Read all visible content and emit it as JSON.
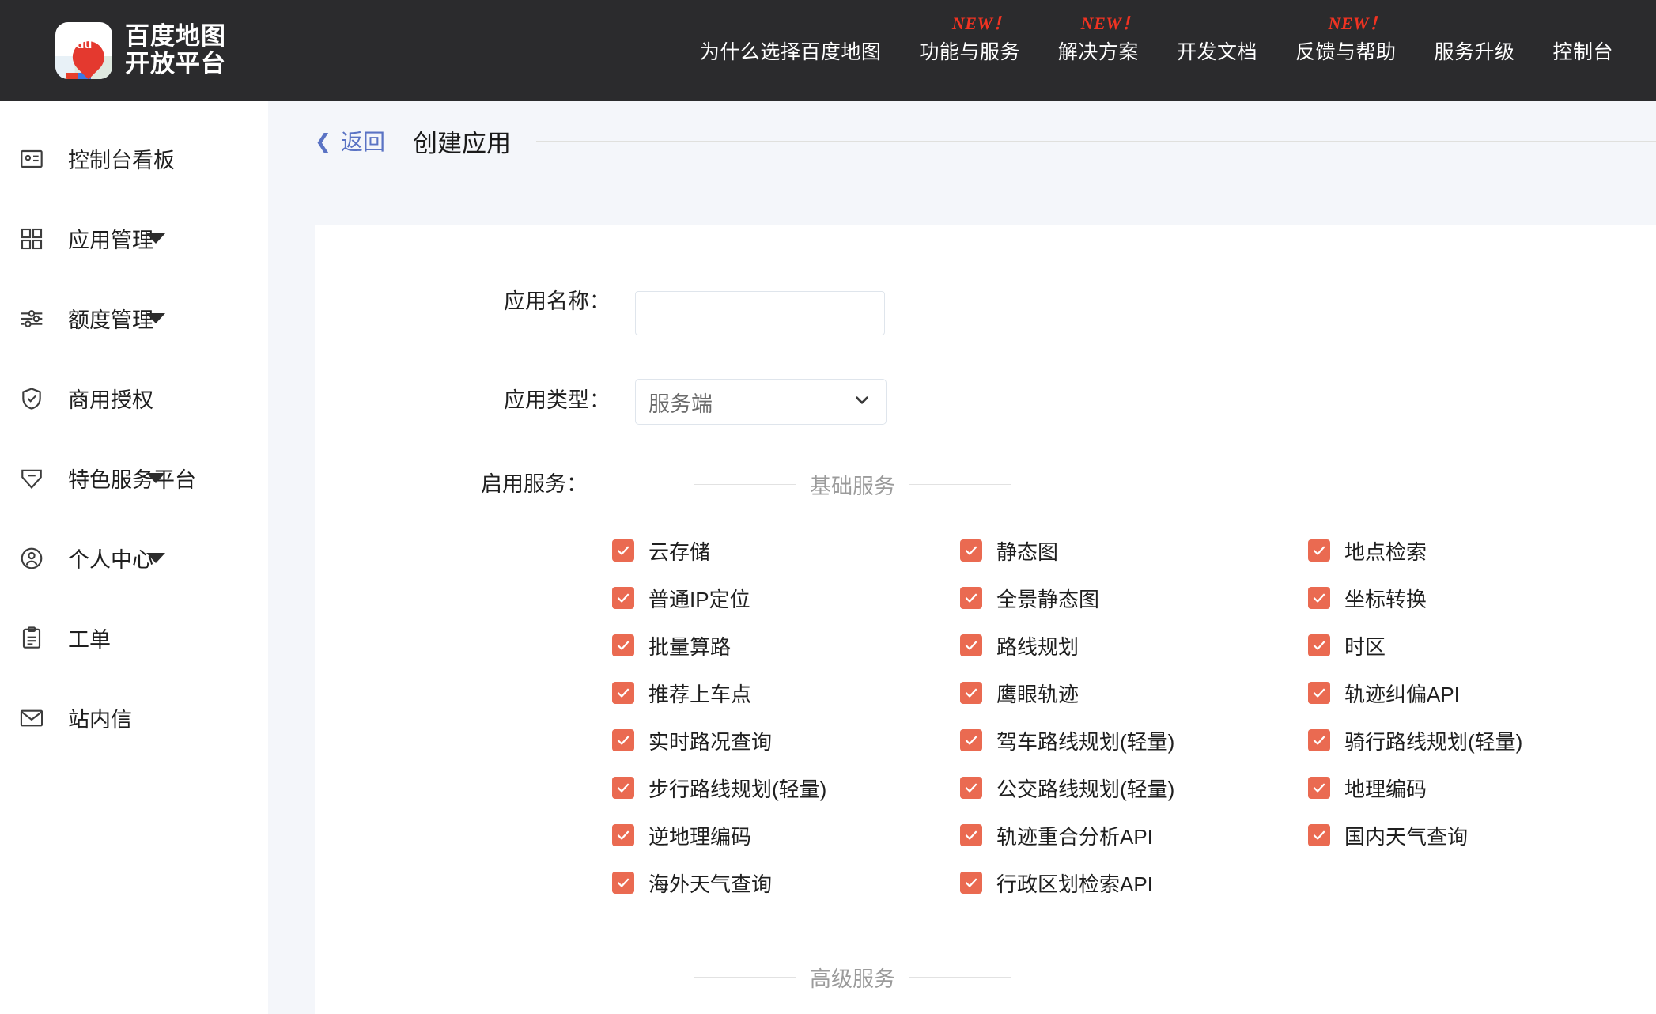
{
  "brand": {
    "logo_text": "du",
    "line1": "百度地图",
    "line2": "开放平台"
  },
  "topnav": {
    "items": [
      {
        "label": "为什么选择百度地图",
        "badge": ""
      },
      {
        "label": "功能与服务",
        "badge": "NEW！"
      },
      {
        "label": "解决方案",
        "badge": "NEW！"
      },
      {
        "label": "开发文档",
        "badge": ""
      },
      {
        "label": "反馈与帮助",
        "badge": "NEW！"
      },
      {
        "label": "服务升级",
        "badge": ""
      },
      {
        "label": "控制台",
        "badge": ""
      }
    ]
  },
  "sidebar": {
    "items": [
      {
        "label": "控制台看板",
        "icon": "dashboard-card-icon",
        "expandable": false
      },
      {
        "label": "应用管理",
        "icon": "grid-icon",
        "expandable": true
      },
      {
        "label": "额度管理",
        "icon": "sliders-icon",
        "expandable": true
      },
      {
        "label": "商用授权",
        "icon": "shield-check-icon",
        "expandable": false
      },
      {
        "label": "特色服务平台",
        "icon": "tag-icon",
        "expandable": true
      },
      {
        "label": "个人中心",
        "icon": "user-circle-icon",
        "expandable": true
      },
      {
        "label": "工单",
        "icon": "clipboard-icon",
        "expandable": false
      },
      {
        "label": "站内信",
        "icon": "mail-icon",
        "expandable": false
      }
    ]
  },
  "page": {
    "back_label": "返回",
    "title": "创建应用"
  },
  "form": {
    "app_name": {
      "label": "应用名称：",
      "value": "",
      "placeholder": ""
    },
    "app_type": {
      "label": "应用类型：",
      "value": "服务端"
    },
    "enable_services": {
      "label": "启用服务："
    }
  },
  "sections": [
    {
      "caption": "基础服务",
      "services": [
        {
          "label": "云存储",
          "checked": true
        },
        {
          "label": "静态图",
          "checked": true
        },
        {
          "label": "地点检索",
          "checked": true
        },
        {
          "label": "普通IP定位",
          "checked": true
        },
        {
          "label": "全景静态图",
          "checked": true
        },
        {
          "label": "坐标转换",
          "checked": true
        },
        {
          "label": "批量算路",
          "checked": true
        },
        {
          "label": "路线规划",
          "checked": true
        },
        {
          "label": "时区",
          "checked": true
        },
        {
          "label": "推荐上车点",
          "checked": true
        },
        {
          "label": "鹰眼轨迹",
          "checked": true
        },
        {
          "label": "轨迹纠偏API",
          "checked": true
        },
        {
          "label": "实时路况查询",
          "checked": true
        },
        {
          "label": "驾车路线规划(轻量)",
          "checked": true
        },
        {
          "label": "骑行路线规划(轻量)",
          "checked": true
        },
        {
          "label": "步行路线规划(轻量)",
          "checked": true
        },
        {
          "label": "公交路线规划(轻量)",
          "checked": true
        },
        {
          "label": "地理编码",
          "checked": true
        },
        {
          "label": "逆地理编码",
          "checked": true
        },
        {
          "label": "轨迹重合分析API",
          "checked": true
        },
        {
          "label": "国内天气查询",
          "checked": true
        },
        {
          "label": "海外天气查询",
          "checked": true
        },
        {
          "label": "行政区划检索API",
          "checked": true
        }
      ]
    },
    {
      "caption": "高级服务",
      "services": []
    }
  ],
  "colors": {
    "topnav_bg": "#2b2b2d",
    "accent_red": "#ea6a51",
    "badge_red": "#f03322",
    "link_blue": "#5a73c4",
    "page_bg": "#f4f6fa"
  }
}
